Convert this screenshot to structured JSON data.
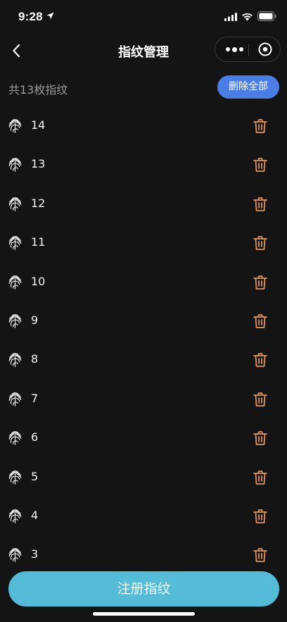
{
  "status_bar": {
    "time": "9:28"
  },
  "nav": {
    "title": "指纹管理"
  },
  "header": {
    "count_label": "共13枚指纹",
    "delete_all_label": "删除全部"
  },
  "fingerprints": [
    {
      "label": "14"
    },
    {
      "label": "13"
    },
    {
      "label": "12"
    },
    {
      "label": "11"
    },
    {
      "label": "10"
    },
    {
      "label": "9"
    },
    {
      "label": "8"
    },
    {
      "label": "7"
    },
    {
      "label": "6"
    },
    {
      "label": "5"
    },
    {
      "label": "4"
    },
    {
      "label": "3"
    }
  ],
  "footer": {
    "register_label": "注册指纹"
  },
  "colors": {
    "accent_blue": "#4a7de6",
    "register_button": "#55bcd8",
    "trash_orange": "#e0955a",
    "background": "#141414"
  },
  "icons": [
    "location-arrow-icon",
    "signal-icon",
    "wifi-icon",
    "battery-icon",
    "back-chevron-icon",
    "more-dots-icon",
    "target-circle-icon",
    "fingerprint-icon",
    "trash-icon"
  ]
}
